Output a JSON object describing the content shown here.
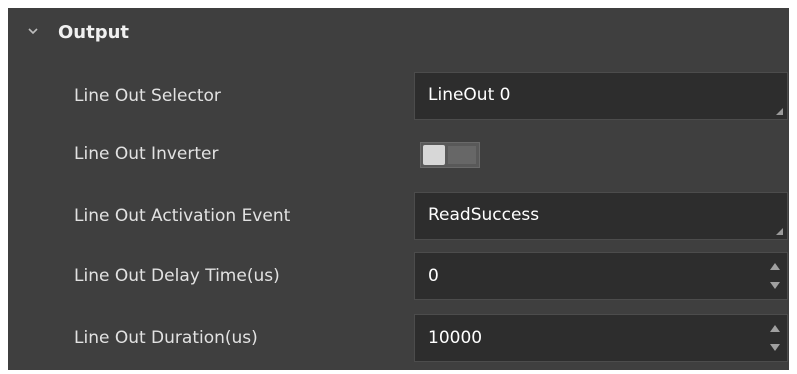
{
  "section": {
    "title": "Output",
    "expanded": true,
    "chevron_icon": "chevron-down-icon"
  },
  "rows": {
    "line_out_selector": {
      "label": "Line Out Selector",
      "value": "LineOut 0",
      "control": "dropdown"
    },
    "line_out_inverter": {
      "label": "Line Out Inverter",
      "state": "off",
      "control": "toggle"
    },
    "line_out_activation_event": {
      "label": "Line Out Activation Event",
      "value": "ReadSuccess",
      "control": "dropdown"
    },
    "line_out_delay_time": {
      "label": "Line Out Delay Time(us)",
      "value": "0",
      "control": "spinbox"
    },
    "line_out_duration": {
      "label": "Line Out Duration(us)",
      "value": "10000",
      "control": "spinbox"
    }
  },
  "colors": {
    "panel_bg": "#3f3f3f",
    "field_bg": "#2d2d2d",
    "text": "#e2e2e2"
  }
}
